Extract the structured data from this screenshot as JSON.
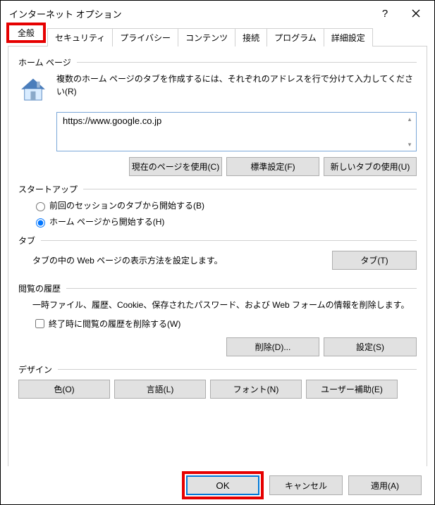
{
  "window": {
    "title": "インターネット オプション"
  },
  "tabs": [
    "全般",
    "セキュリティ",
    "プライバシー",
    "コンテンツ",
    "接続",
    "プログラム",
    "詳細設定"
  ],
  "homepage": {
    "header": "ホーム ページ",
    "desc": "複数のホーム ページのタブを作成するには、それぞれのアドレスを行で分けて入力してください(R)",
    "url": "https://www.google.co.jp",
    "btn_current": "現在のページを使用(C)",
    "btn_default": "標準設定(F)",
    "btn_newtab": "新しいタブの使用(U)"
  },
  "startup": {
    "header": "スタートアップ",
    "opt_last": "前回のセッションのタブから開始する(B)",
    "opt_home": "ホーム ページから開始する(H)"
  },
  "tabsect": {
    "header": "タブ",
    "desc": "タブの中の Web ページの表示方法を設定します。",
    "btn": "タブ(T)"
  },
  "history": {
    "header": "閲覧の履歴",
    "desc": "一時ファイル、履歴、Cookie、保存されたパスワード、および Web フォームの情報を削除します。",
    "chk": "終了時に閲覧の履歴を削除する(W)",
    "btn_delete": "削除(D)...",
    "btn_settings": "設定(S)"
  },
  "design": {
    "header": "デザイン",
    "btn_color": "色(O)",
    "btn_lang": "言語(L)",
    "btn_font": "フォント(N)",
    "btn_access": "ユーザー補助(E)"
  },
  "footer": {
    "ok": "OK",
    "cancel": "キャンセル",
    "apply": "適用(A)"
  }
}
